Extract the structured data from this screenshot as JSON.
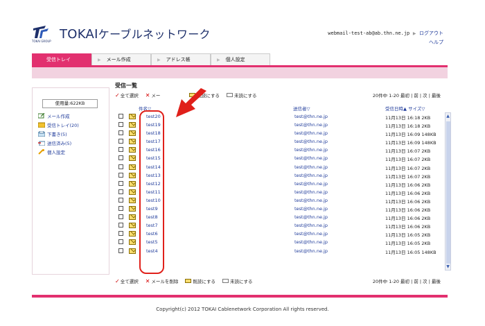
{
  "header": {
    "logo_sub": "TOKAI GROUP",
    "brand_latin": "TOKAI",
    "brand_kana": "ケーブルネットワーク",
    "user_email": "webmail-test-ab@ab.thn.ne.jp",
    "logout": "ログアウト",
    "help": "ヘルプ"
  },
  "tabs": [
    {
      "label": "受信トレイ",
      "active": true
    },
    {
      "label": "メール作成",
      "active": false
    },
    {
      "label": "アドレス帳",
      "active": false
    },
    {
      "label": "個人設定",
      "active": false
    }
  ],
  "sidebar": {
    "usage": "使用量:622KB",
    "items": [
      {
        "label": "メール作成",
        "icon": "compose-icon"
      },
      {
        "label": "受信トレイ(20)",
        "icon": "inbox-icon"
      },
      {
        "label": "下書き(5)",
        "icon": "drafts-icon"
      },
      {
        "label": "送信済み(5)",
        "icon": "sent-icon"
      },
      {
        "label": "個人設定",
        "icon": "settings-icon"
      }
    ]
  },
  "main": {
    "title": "受信一覧",
    "toolbar": {
      "select_all": "全て選択",
      "delete": "メールを削除",
      "delete_short": "メー",
      "mark_read": "既読にする",
      "mark_unread": "未読にする"
    },
    "pager": "20件中 1-20  最初 | 前 | 次 | 最後",
    "columns": {
      "subject": "件名▽",
      "from": "送信者▽",
      "date": "受信日時▲ サイズ▽"
    },
    "rows": [
      {
        "subject": "test20",
        "from": "test@thn.ne.jp",
        "date": "11月13日 16:18  2KB"
      },
      {
        "subject": "test19",
        "from": "test@thn.ne.jp",
        "date": "11月13日 16:18  2KB"
      },
      {
        "subject": "test18",
        "from": "test@thn.ne.jp",
        "date": "11月13日 16:09  148KB"
      },
      {
        "subject": "test17",
        "from": "test@thn.ne.jp",
        "date": "11月13日 16:09  148KB"
      },
      {
        "subject": "test16",
        "from": "test@thn.ne.jp",
        "date": "11月13日 16:07  2KB"
      },
      {
        "subject": "test15",
        "from": "test@thn.ne.jp",
        "date": "11月13日 16:07  2KB"
      },
      {
        "subject": "test14",
        "from": "test@thn.ne.jp",
        "date": "11月13日 16:07  2KB"
      },
      {
        "subject": "test13",
        "from": "test@thn.ne.jp",
        "date": "11月13日 16:07  2KB"
      },
      {
        "subject": "test12",
        "from": "test@thn.ne.jp",
        "date": "11月13日 16:06  2KB"
      },
      {
        "subject": "test11",
        "from": "test@thn.ne.jp",
        "date": "11月13日 16:06  2KB"
      },
      {
        "subject": "test10",
        "from": "test@thn.ne.jp",
        "date": "11月13日 16:06  2KB"
      },
      {
        "subject": "test9",
        "from": "test@thn.ne.jp",
        "date": "11月13日 16:06  2KB"
      },
      {
        "subject": "test8",
        "from": "test@thn.ne.jp",
        "date": "11月13日 16:06  2KB"
      },
      {
        "subject": "test7",
        "from": "test@thn.ne.jp",
        "date": "11月13日 16:06  2KB"
      },
      {
        "subject": "test6",
        "from": "test@thn.ne.jp",
        "date": "11月13日 16:05  2KB"
      },
      {
        "subject": "test5",
        "from": "test@thn.ne.jp",
        "date": "11月13日 16:05  2KB"
      },
      {
        "subject": "test4",
        "from": "test@thn.ne.jp",
        "date": "11月13日 16:05  148KB"
      }
    ]
  },
  "footer": {
    "copyright": "Copyright(c) 2012 TOKAI Cablenetwork Corporation All rights reserved."
  },
  "colors": {
    "accent": "#e2306f",
    "band": "#f2d2e0",
    "brand": "#1d2f6a",
    "link": "#1e3a9a",
    "annotation": "#e0201a"
  }
}
